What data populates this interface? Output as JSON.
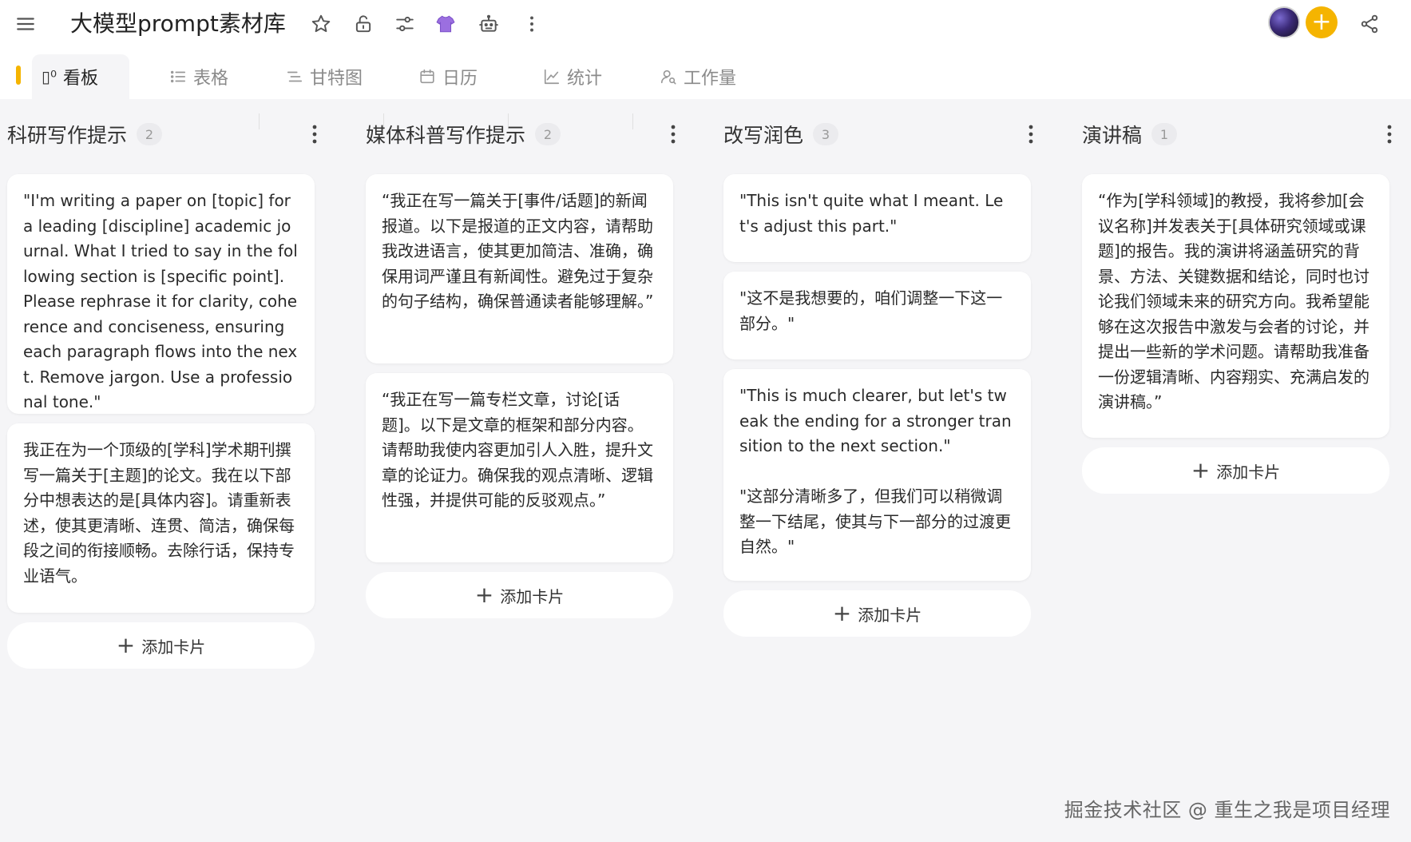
{
  "header": {
    "title": "大模型prompt素材库",
    "icons": [
      "menu-icon",
      "star-icon",
      "unlock-icon",
      "sliders-icon",
      "shirt-icon",
      "robot-icon",
      "more-icon",
      "share-icon"
    ],
    "add_label": "+"
  },
  "tabs": [
    {
      "label": "看板",
      "icon": "kanban-icon",
      "active": true
    },
    {
      "label": "表格",
      "icon": "list-icon",
      "active": false
    },
    {
      "label": "甘特图",
      "icon": "gantt-icon",
      "active": false
    },
    {
      "label": "日历",
      "icon": "calendar-icon",
      "active": false
    },
    {
      "label": "统计",
      "icon": "chart-icon",
      "active": false
    },
    {
      "label": "工作量",
      "icon": "person-icon",
      "active": false
    }
  ],
  "columns": [
    {
      "title": "科研写作提示",
      "count": "2",
      "cards": [
        "\"I'm writing a paper on [topic] for a leading [discipline] academic journal. What I tried to say in the following section is [specific point]. Please rephrase it for clarity, coherence and conciseness, ensuring each paragraph flows into the next. Remove jargon. Use a professional tone.\"",
        "我正在为一个顶级的[学科]学术期刊撰写一篇关于[主题]的论文。我在以下部分中想表达的是[具体内容]。请重新表述，使其更清晰、连贯、简洁，确保每段之间的衔接顺畅。去除行话，保持专业语气。"
      ],
      "add_label": "添加卡片"
    },
    {
      "title": "媒体科普写作提示",
      "count": "2",
      "cards": [
        "“我正在写一篇关于[事件/话题]的新闻报道。以下是报道的正文内容，请帮助我改进语言，使其更加简洁、准确，确保用词严谨且有新闻性。避免过于复杂的句子结构，确保普通读者能够理解。”",
        "“我正在写一篇专栏文章，讨论[话题]。以下是文章的框架和部分内容。请帮助我使内容更加引人入胜，提升文章的论证力。确保我的观点清晰、逻辑性强，并提供可能的反驳观点。”"
      ],
      "add_label": "添加卡片"
    },
    {
      "title": "改写润色",
      "count": "3",
      "cards": [
        "\"This isn't quite what I meant. Let's adjust this part.\"",
        "\"这不是我想要的，咱们调整一下这一部分。\"",
        "\"This is much clearer, but let's tweak the ending for a stronger transition to the next section.\"\n\n\"这部分清晰多了，但我们可以稍微调整一下结尾，使其与下一部分的过渡更自然。\""
      ],
      "add_label": "添加卡片"
    },
    {
      "title": "演讲稿",
      "count": "1",
      "cards": [
        "“作为[学科领域]的教授，我将参加[会议名称]并发表关于[具体研究领域或课题]的报告。我的演讲将涵盖研究的背景、方法、关键数据和结论，同时也讨论我们领域未来的研究方向。我希望能够在这次报告中激发与会者的讨论，并提出一些新的学术问题。请帮助我准备一份逻辑清晰、内容翔实、充满启发的演讲稿。”"
      ],
      "add_label": "添加卡片"
    }
  ],
  "watermark": "掘金技术社区 @ 重生之我是项目经理",
  "colors": {
    "accent": "#f5b400",
    "background": "#f5f5f7",
    "card": "#ffffff"
  }
}
